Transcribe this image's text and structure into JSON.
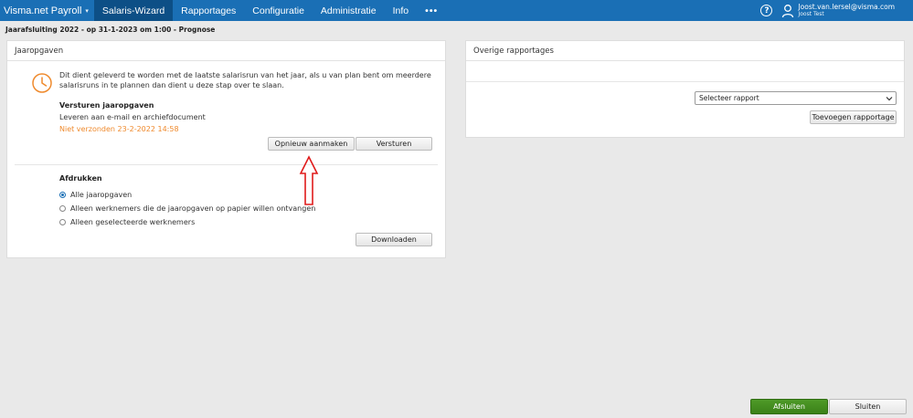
{
  "nav": {
    "brand": "Visma.net Payroll",
    "tabs": [
      {
        "label": "Salaris-Wizard",
        "active": true
      },
      {
        "label": "Rapportages",
        "active": false
      },
      {
        "label": "Configuratie",
        "active": false
      },
      {
        "label": "Administratie",
        "active": false
      },
      {
        "label": "Info",
        "active": false
      }
    ],
    "more": "•••",
    "help": "?",
    "user_email": "Joost.van.Iersel@visma.com",
    "user_name": "Joost Test"
  },
  "breadcrumb": "Jaarafsluiting 2022 - op 31-1-2023 om 1:00 - Prognose",
  "left_panel": {
    "title": "Jaaropgaven",
    "intro": "Dit dient geleverd te worden met de laatste salarisrun van het jaar, als u van plan bent om meerdere salarisruns in te plannen dan dient u deze stap over te slaan.",
    "send_title": "Versturen jaaropgaven",
    "send_desc": "Leveren aan e-mail en archiefdocument",
    "status": "Niet verzonden 23-2-2022 14:58",
    "btn_recreate": "Opnieuw aanmaken",
    "btn_send": "Versturen",
    "print_title": "Afdrukken",
    "options": [
      {
        "label": "Alle jaaropgaven",
        "checked": true
      },
      {
        "label": "Alleen werknemers die de jaaropgaven op papier willen ontvangen",
        "checked": false
      },
      {
        "label": "Alleen geselecteerde werknemers",
        "checked": false
      }
    ],
    "btn_download": "Downloaden"
  },
  "right_panel": {
    "title": "Overige rapportages",
    "select_value": "Selecteer rapport",
    "btn_add": "Toevoegen rapportage"
  },
  "footer": {
    "btn_finish": "Afsluiten",
    "btn_close": "Sluiten"
  },
  "colors": {
    "nav_bg": "#1a6fb5",
    "nav_active": "#0d4f86",
    "status_orange": "#ef8a2d",
    "clock_orange": "#ef8a2d",
    "arrow_red": "#e01b1b",
    "finish_green": "#3f8a1d"
  },
  "icons": [
    "chevron-down-icon",
    "help-icon",
    "user-icon",
    "clock-icon",
    "arrow-up-icon",
    "select-caret-icon"
  ]
}
